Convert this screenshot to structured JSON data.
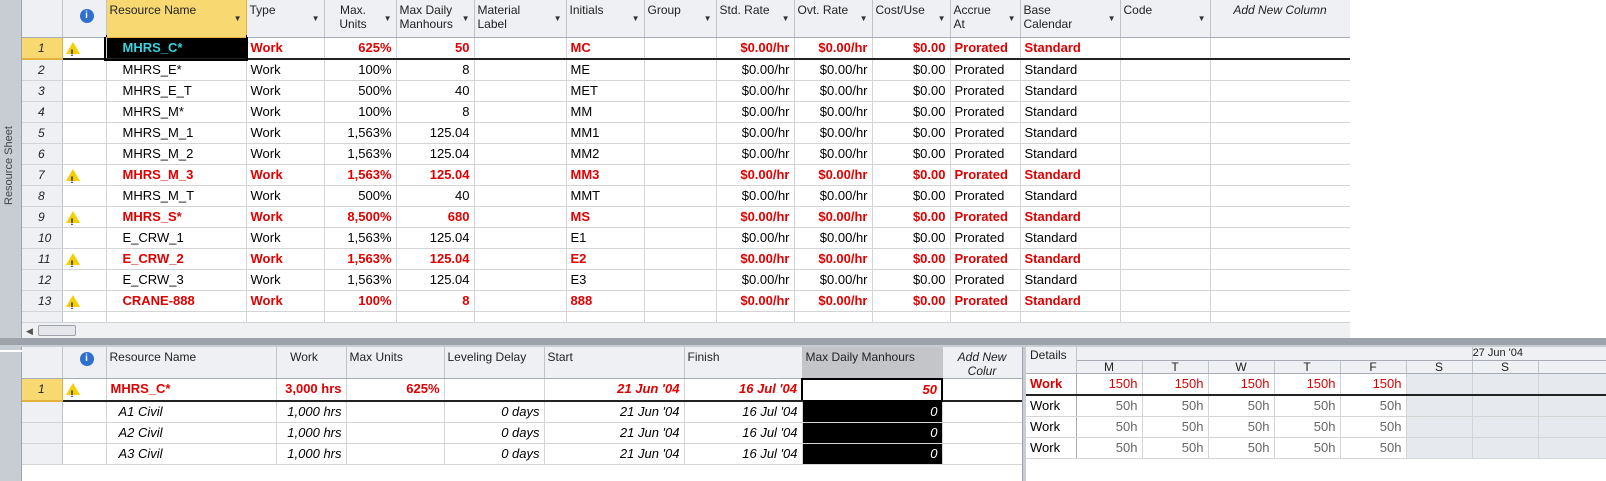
{
  "sidebar": {
    "label": "Resource Sheet"
  },
  "resource_sheet": {
    "columns": [
      {
        "label": "Resource Name"
      },
      {
        "label": "Type"
      },
      {
        "label": "Max. Units"
      },
      {
        "label": "Max Daily Manhours"
      },
      {
        "label": "Material Label"
      },
      {
        "label": "Initials"
      },
      {
        "label": "Group"
      },
      {
        "label": "Std. Rate"
      },
      {
        "label": "Ovt. Rate"
      },
      {
        "label": "Cost/Use"
      },
      {
        "label": "Accrue At"
      },
      {
        "label": "Base Calendar"
      },
      {
        "label": "Code"
      }
    ],
    "add_new_column": "Add New Column",
    "info_icon": "i",
    "rows": [
      {
        "id": "1",
        "warn": true,
        "name": "MHRS_C*",
        "type": "Work",
        "max_units": "625%",
        "mdm": "50",
        "material": "",
        "initials": "MC",
        "group": "",
        "std_rate": "$0.00/hr",
        "ovt_rate": "$0.00/hr",
        "cost_use": "$0.00",
        "accrue": "Prorated",
        "calendar": "Standard",
        "code": ""
      },
      {
        "id": "2",
        "warn": false,
        "name": "MHRS_E*",
        "type": "Work",
        "max_units": "100%",
        "mdm": "8",
        "material": "",
        "initials": "ME",
        "group": "",
        "std_rate": "$0.00/hr",
        "ovt_rate": "$0.00/hr",
        "cost_use": "$0.00",
        "accrue": "Prorated",
        "calendar": "Standard",
        "code": ""
      },
      {
        "id": "3",
        "warn": false,
        "name": "MHRS_E_T",
        "type": "Work",
        "max_units": "500%",
        "mdm": "40",
        "material": "",
        "initials": "MET",
        "group": "",
        "std_rate": "$0.00/hr",
        "ovt_rate": "$0.00/hr",
        "cost_use": "$0.00",
        "accrue": "Prorated",
        "calendar": "Standard",
        "code": ""
      },
      {
        "id": "4",
        "warn": false,
        "name": "MHRS_M*",
        "type": "Work",
        "max_units": "100%",
        "mdm": "8",
        "material": "",
        "initials": "MM",
        "group": "",
        "std_rate": "$0.00/hr",
        "ovt_rate": "$0.00/hr",
        "cost_use": "$0.00",
        "accrue": "Prorated",
        "calendar": "Standard",
        "code": ""
      },
      {
        "id": "5",
        "warn": false,
        "name": "MHRS_M_1",
        "type": "Work",
        "max_units": "1,563%",
        "mdm": "125.04",
        "material": "",
        "initials": "MM1",
        "group": "",
        "std_rate": "$0.00/hr",
        "ovt_rate": "$0.00/hr",
        "cost_use": "$0.00",
        "accrue": "Prorated",
        "calendar": "Standard",
        "code": ""
      },
      {
        "id": "6",
        "warn": false,
        "name": "MHRS_M_2",
        "type": "Work",
        "max_units": "1,563%",
        "mdm": "125.04",
        "material": "",
        "initials": "MM2",
        "group": "",
        "std_rate": "$0.00/hr",
        "ovt_rate": "$0.00/hr",
        "cost_use": "$0.00",
        "accrue": "Prorated",
        "calendar": "Standard",
        "code": ""
      },
      {
        "id": "7",
        "warn": true,
        "name": "MHRS_M_3",
        "type": "Work",
        "max_units": "1,563%",
        "mdm": "125.04",
        "material": "",
        "initials": "MM3",
        "group": "",
        "std_rate": "$0.00/hr",
        "ovt_rate": "$0.00/hr",
        "cost_use": "$0.00",
        "accrue": "Prorated",
        "calendar": "Standard",
        "code": ""
      },
      {
        "id": "8",
        "warn": false,
        "name": "MHRS_M_T",
        "type": "Work",
        "max_units": "500%",
        "mdm": "40",
        "material": "",
        "initials": "MMT",
        "group": "",
        "std_rate": "$0.00/hr",
        "ovt_rate": "$0.00/hr",
        "cost_use": "$0.00",
        "accrue": "Prorated",
        "calendar": "Standard",
        "code": ""
      },
      {
        "id": "9",
        "warn": true,
        "name": "MHRS_S*",
        "type": "Work",
        "max_units": "8,500%",
        "mdm": "680",
        "material": "",
        "initials": "MS",
        "group": "",
        "std_rate": "$0.00/hr",
        "ovt_rate": "$0.00/hr",
        "cost_use": "$0.00",
        "accrue": "Prorated",
        "calendar": "Standard",
        "code": ""
      },
      {
        "id": "10",
        "warn": false,
        "name": "E_CRW_1",
        "type": "Work",
        "max_units": "1,563%",
        "mdm": "125.04",
        "material": "",
        "initials": "E1",
        "group": "",
        "std_rate": "$0.00/hr",
        "ovt_rate": "$0.00/hr",
        "cost_use": "$0.00",
        "accrue": "Prorated",
        "calendar": "Standard",
        "code": ""
      },
      {
        "id": "11",
        "warn": true,
        "name": "E_CRW_2",
        "type": "Work",
        "max_units": "1,563%",
        "mdm": "125.04",
        "material": "",
        "initials": "E2",
        "group": "",
        "std_rate": "$0.00/hr",
        "ovt_rate": "$0.00/hr",
        "cost_use": "$0.00",
        "accrue": "Prorated",
        "calendar": "Standard",
        "code": ""
      },
      {
        "id": "12",
        "warn": false,
        "name": "E_CRW_3",
        "type": "Work",
        "max_units": "1,563%",
        "mdm": "125.04",
        "material": "",
        "initials": "E3",
        "group": "",
        "std_rate": "$0.00/hr",
        "ovt_rate": "$0.00/hr",
        "cost_use": "$0.00",
        "accrue": "Prorated",
        "calendar": "Standard",
        "code": ""
      },
      {
        "id": "13",
        "warn": true,
        "name": "CRANE-888",
        "type": "Work",
        "max_units": "100%",
        "mdm": "8",
        "material": "",
        "initials": "888",
        "group": "",
        "std_rate": "$0.00/hr",
        "ovt_rate": "$0.00/hr",
        "cost_use": "$0.00",
        "accrue": "Prorated",
        "calendar": "Standard",
        "code": ""
      }
    ]
  },
  "resource_usage": {
    "columns": [
      {
        "label": "Resource Name"
      },
      {
        "label": "Work"
      },
      {
        "label": "Max Units"
      },
      {
        "label": "Leveling Delay"
      },
      {
        "label": "Start"
      },
      {
        "label": "Finish"
      },
      {
        "label": "Max Daily Manhours"
      }
    ],
    "add_new_column": "Add New Colur",
    "rows": [
      {
        "id": "1",
        "warn": true,
        "name": "MHRS_C*",
        "work": "3,000 hrs",
        "max_units": "625%",
        "leveling_delay": "",
        "start": "21 Jun '04",
        "finish": "16 Jul '04",
        "mdm": "50"
      },
      {
        "id": "",
        "warn": false,
        "name": "A1 Civil",
        "work": "1,000 hrs",
        "max_units": "",
        "leveling_delay": "0 days",
        "start": "21 Jun '04",
        "finish": "16 Jul '04",
        "mdm": "0"
      },
      {
        "id": "",
        "warn": false,
        "name": "A2 Civil",
        "work": "1,000 hrs",
        "max_units": "",
        "leveling_delay": "0 days",
        "start": "21 Jun '04",
        "finish": "16 Jul '04",
        "mdm": "0"
      },
      {
        "id": "",
        "warn": false,
        "name": "A3 Civil",
        "work": "1,000 hrs",
        "max_units": "",
        "leveling_delay": "0 days",
        "start": "21 Jun '04",
        "finish": "16 Jul '04",
        "mdm": "0"
      }
    ]
  },
  "timescale": {
    "details_label": "Details",
    "week_label": "27 Jun '04",
    "days": [
      "M",
      "T",
      "W",
      "T",
      "F",
      "S",
      "S"
    ],
    "rows": [
      {
        "detail": "Work",
        "values": [
          "150h",
          "150h",
          "150h",
          "150h",
          "150h",
          "",
          ""
        ]
      },
      {
        "detail": "Work",
        "values": [
          "50h",
          "50h",
          "50h",
          "50h",
          "50h",
          "",
          ""
        ]
      },
      {
        "detail": "Work",
        "values": [
          "50h",
          "50h",
          "50h",
          "50h",
          "50h",
          "",
          ""
        ]
      },
      {
        "detail": "Work",
        "values": [
          "50h",
          "50h",
          "50h",
          "50h",
          "50h",
          "",
          ""
        ]
      }
    ]
  },
  "colors": {
    "overallocated": "#e00000",
    "selected_header": "#f8d871",
    "active_cell_text": "#38d4e0"
  }
}
